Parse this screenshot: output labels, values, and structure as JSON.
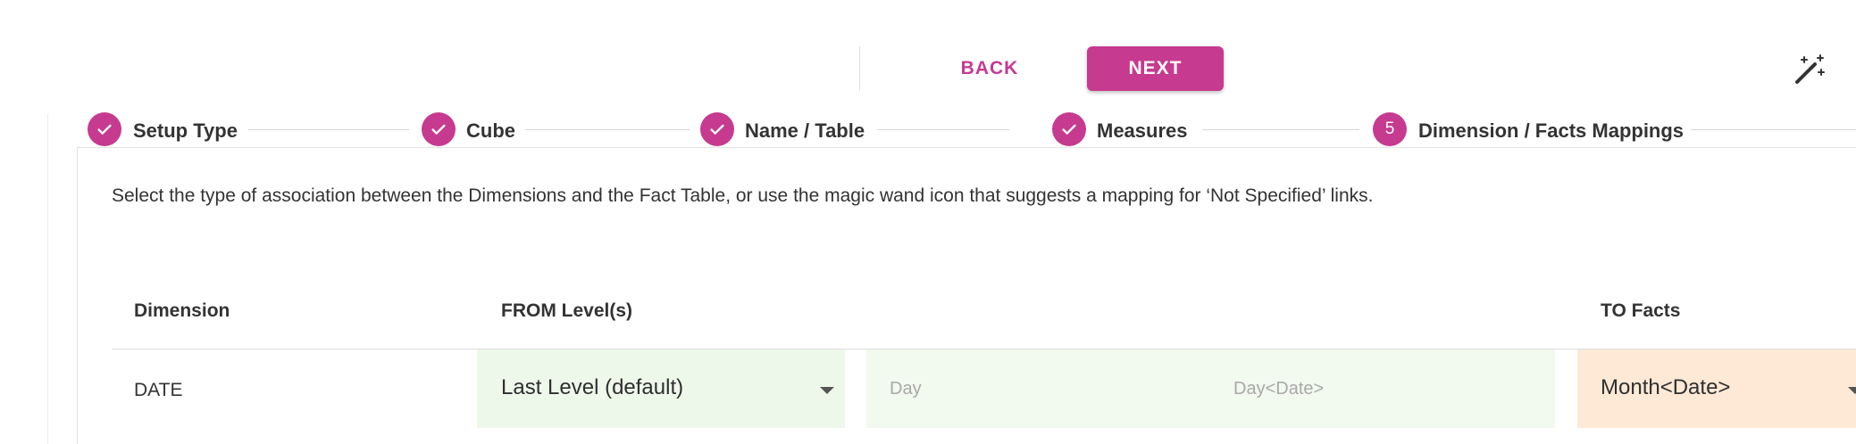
{
  "toolbar": {
    "back_label": "BACK",
    "next_label": "NEXT",
    "wand_icon": "magic-wand-icon"
  },
  "colors": {
    "accent": "#c63a8f",
    "from_bg": "#eef8ea",
    "to_bg": "#fde9d6"
  },
  "stepper": {
    "steps": [
      {
        "label": "Setup Type",
        "state": "done",
        "icon": "check-icon"
      },
      {
        "label": "Cube",
        "state": "done",
        "icon": "check-icon"
      },
      {
        "label": "Name / Table",
        "state": "done",
        "icon": "check-icon"
      },
      {
        "label": "Measures",
        "state": "done",
        "icon": "check-icon"
      },
      {
        "label": "Dimension / Facts Mappings",
        "state": "active",
        "number": "5"
      }
    ]
  },
  "instructions": "Select the type of association between the Dimensions and the Fact Table, or use the magic wand icon that suggests a mapping for ‘Not Specified’ links.",
  "table": {
    "headers": {
      "dimension": "Dimension",
      "from": "FROM Level(s)",
      "to": "TO Facts"
    },
    "rows": [
      {
        "dimension": "DATE",
        "from_value": "Last Level (default)",
        "from_level": "Day",
        "from_key": "Day<Date>",
        "to_value": "Month<Date>"
      }
    ]
  }
}
